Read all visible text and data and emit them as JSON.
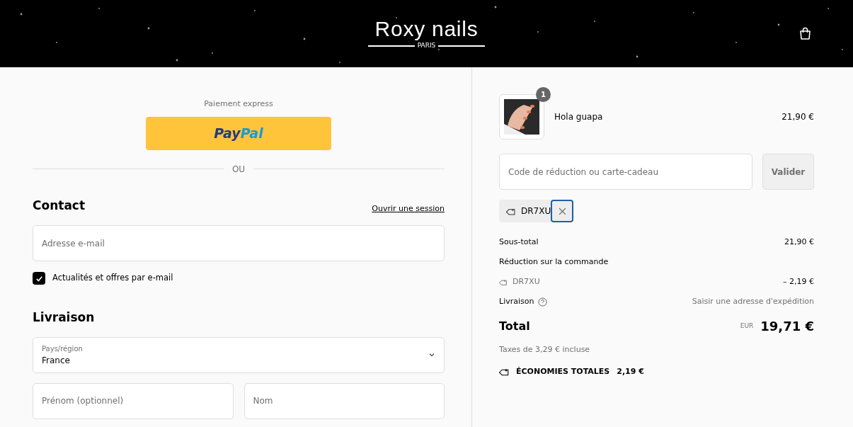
{
  "header": {
    "logo": "Roxy nails",
    "logo_subtitle": "PARIS"
  },
  "express": {
    "label": "Paiement express",
    "paypal": [
      "Pay",
      "Pal"
    ],
    "separator": "OU"
  },
  "contact": {
    "title": "Contact",
    "login_link": "Ouvrir une session",
    "email": {
      "placeholder": "Adresse e-mail"
    },
    "newsletter": {
      "label": "Actualités et offres par e-mail",
      "checked": true
    }
  },
  "delivery": {
    "title": "Livraison",
    "country": {
      "label": "Pays/région",
      "value": "France"
    },
    "first_name": {
      "placeholder": "Prénom (optionnel)"
    },
    "last_name": {
      "placeholder": "Nom"
    }
  },
  "cart": {
    "items": [
      {
        "name": "Hola guapa",
        "price": "21,90 €",
        "quantity": "1"
      }
    ],
    "discount": {
      "placeholder": "Code de réduction ou carte-cadeau",
      "button": "Valider",
      "applied": "DR7XU"
    },
    "summary": [
      {
        "kind": "plain",
        "label": "Sous-total",
        "value": "21,90 €"
      },
      {
        "kind": "plain",
        "label": "Réduction sur la commande"
      },
      {
        "kind": "code",
        "label": "DR7XU",
        "value": "– 2,19 €"
      },
      {
        "kind": "help",
        "label": "Livraison",
        "value": "Saisir une adresse d'expédition"
      }
    ],
    "total": {
      "label": "Total",
      "currency": "EUR",
      "value": "19,71 €"
    },
    "taxes": "Taxes de 3,29 € incluse",
    "savings": {
      "label": "ÉCONOMIES TOTALES",
      "value": "2,19 €"
    }
  }
}
